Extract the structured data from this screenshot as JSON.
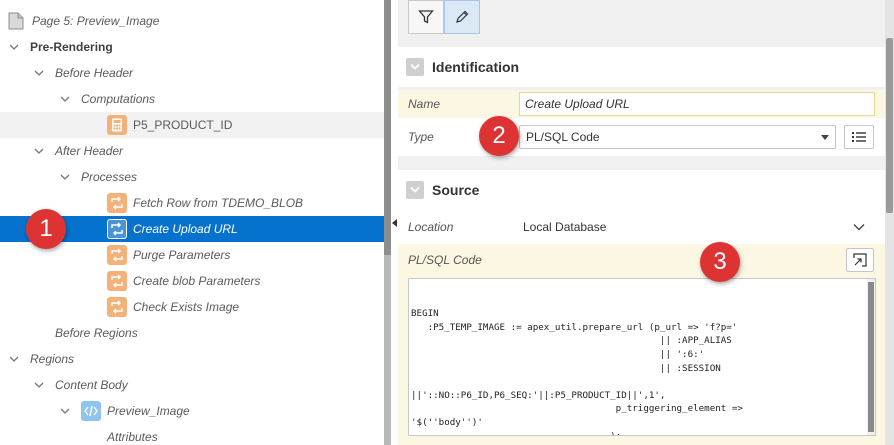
{
  "tree": {
    "page_title": "Page 5: Preview_Image",
    "pre_rendering": "Pre-Rendering",
    "before_header": "Before Header",
    "computations": "Computations",
    "p5_product_id": "P5_PRODUCT_ID",
    "after_header": "After Header",
    "processes": "Processes",
    "fetch_row": "Fetch Row from TDEMO_BLOB",
    "create_upload_url": "Create Upload URL",
    "purge_parameters": "Purge Parameters",
    "create_blob_parameters": "Create blob Parameters",
    "check_exists_image": "Check Exists Image",
    "before_regions": "Before Regions",
    "regions": "Regions",
    "content_body": "Content Body",
    "preview_image": "Preview_Image",
    "attributes": "Attributes"
  },
  "identification": {
    "heading": "Identification",
    "name_label": "Name",
    "name_value": "Create Upload URL",
    "type_label": "Type",
    "type_value": "PL/SQL Code"
  },
  "source": {
    "heading": "Source",
    "location_label": "Location",
    "location_value": "Local Database",
    "code_label": "PL/SQL Code",
    "code": "BEGIN\n   :P5_TEMP_IMAGE := apex_util.prepare_url (p_url => 'f?p='\n                                             || :APP_ALIAS\n                                             || ':6:'\n                                             || :SESSION\n\n||'::NO::P6_ID,P6_SEQ:'||:P5_PRODUCT_ID||',1',\n                                     p_triggering_element =>\n'$(''body'')'\n                                    );\nEND;"
  },
  "badges": {
    "one": "1",
    "two": "2",
    "three": "3"
  },
  "colors": {
    "selection": "#0572ce",
    "badge": "#dd3333",
    "changed_row": "#fcf7e3"
  },
  "icons": {
    "filter": "filter-icon",
    "edit": "pencil-icon",
    "list": "list-icon",
    "expand": "expand-icon"
  }
}
